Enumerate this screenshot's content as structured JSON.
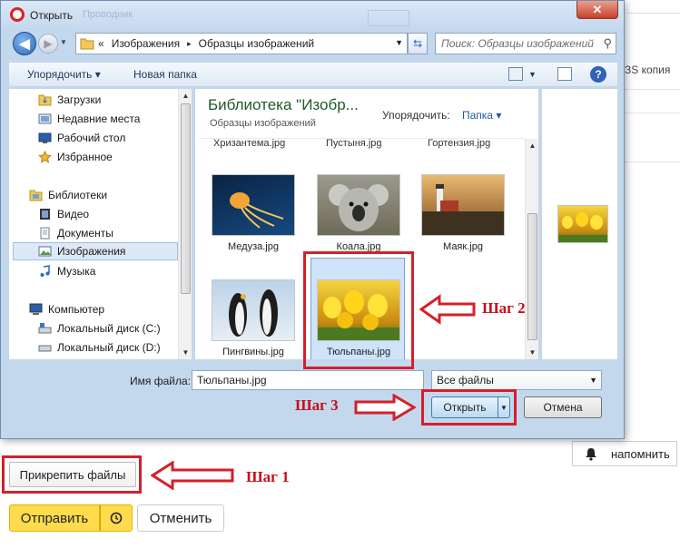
{
  "dialog": {
    "title": "Открыть",
    "close_label": "✕",
    "ghost_tab": "Проводник",
    "nav": {
      "back_glyph": "◀",
      "forward_glyph": "▶",
      "breadcrumb_prefix": "«",
      "breadcrumb": [
        "Изображения",
        "Образцы изображений"
      ],
      "breadcrumb_sep": "▸",
      "search_placeholder": "Поиск: Образцы изображений"
    },
    "toolbar": {
      "organize": "Упорядочить ▾",
      "new_folder": "Новая папка"
    },
    "sidebar": {
      "items": [
        {
          "label": "Загрузки",
          "icon": "downloads-icon"
        },
        {
          "label": "Недавние места",
          "icon": "recent-places-icon"
        },
        {
          "label": "Рабочий стол",
          "icon": "desktop-icon"
        },
        {
          "label": "Избранное",
          "icon": "favorites-star-icon"
        },
        {
          "label": "Библиотеки",
          "icon": "libraries-icon"
        },
        {
          "label": "Видео",
          "icon": "video-icon"
        },
        {
          "label": "Документы",
          "icon": "documents-icon"
        },
        {
          "label": "Изображения",
          "icon": "pictures-icon",
          "selected": true
        },
        {
          "label": "Музыка",
          "icon": "music-icon"
        },
        {
          "label": "Компьютер",
          "icon": "computer-icon"
        },
        {
          "label": "Локальный диск (C:)",
          "icon": "disk-c-icon"
        },
        {
          "label": "Локальный диск (D:)",
          "icon": "disk-d-icon"
        }
      ]
    },
    "library": {
      "title": "Библиотека \"Изобр...",
      "subtitle": "Образцы изображений",
      "arrange_label": "Упорядочить:",
      "arrange_value": "Папка ▾"
    },
    "files": {
      "cut_row": [
        "Хризантема.jpg",
        "Пустыня.jpg",
        "Гортензия.jpg"
      ],
      "items": [
        {
          "label": "Медуза.jpg"
        },
        {
          "label": "Коала.jpg"
        },
        {
          "label": "Маяк.jpg"
        },
        {
          "label": "Пингвины.jpg"
        },
        {
          "label": "Тюльпаны.jpg",
          "selected": true
        }
      ]
    },
    "bottom": {
      "filename_label": "Имя файла:",
      "filename_value": "Тюльпаны.jpg",
      "filetype_value": "Все файлы",
      "open_label": "Открыть",
      "cancel_label": "Отмена"
    }
  },
  "page": {
    "bg_text": "ЗS копия",
    "remind_label": "напомнить",
    "attach_label": "Прикрепить файлы",
    "send_label": "Отправить",
    "cancel_label": "Отменить"
  },
  "annotations": {
    "step1": "Шаг 1",
    "step2": "Шаг 2",
    "step3": "Шаг 3"
  },
  "colors": {
    "annotation_red": "#d4202a",
    "send_yellow": "#ffdb4d",
    "library_title_green": "#1e5a2a"
  }
}
